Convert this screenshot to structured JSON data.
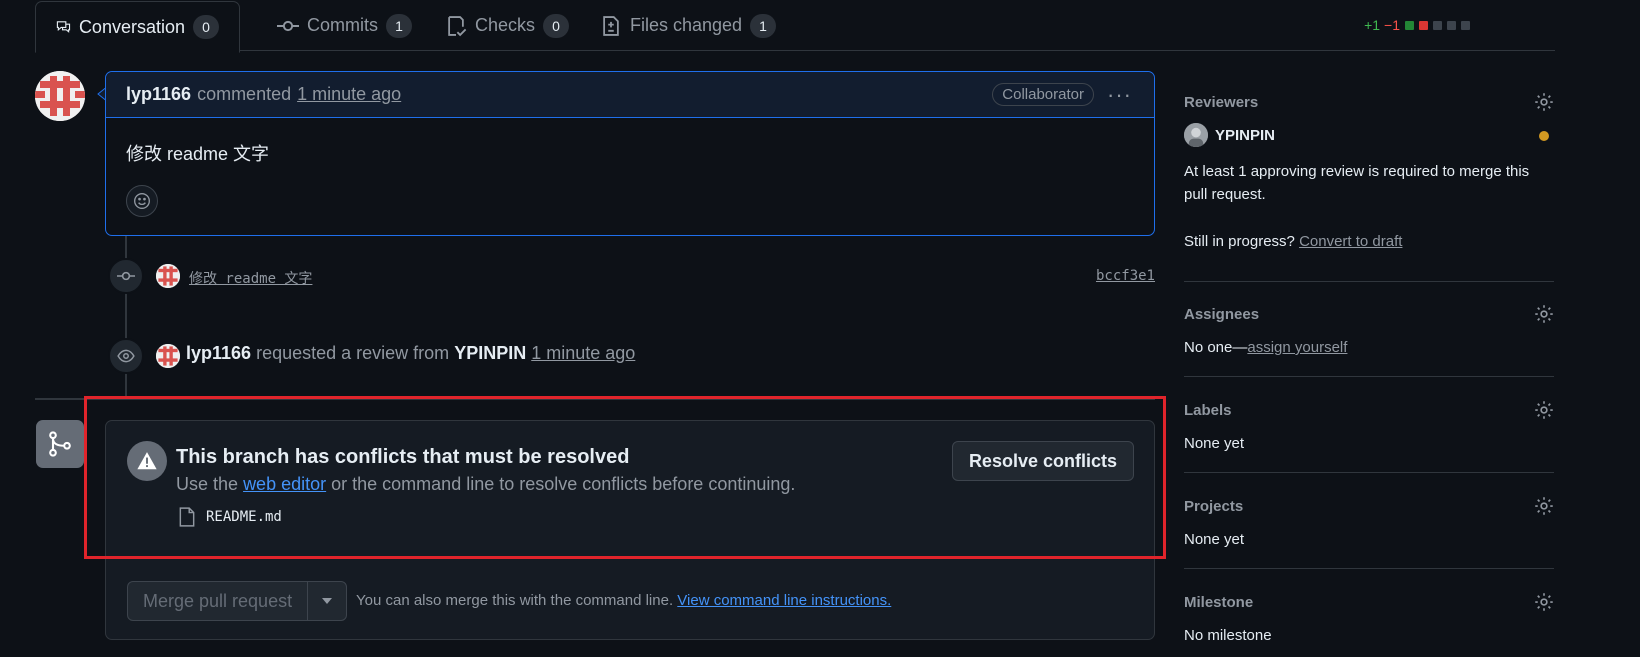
{
  "tabs": [
    {
      "label": "Conversation",
      "count": "0",
      "icon": "comment-discussion-icon"
    },
    {
      "label": "Commits",
      "count": "1",
      "icon": "git-commit-icon"
    },
    {
      "label": "Checks",
      "count": "0",
      "icon": "checklist-icon"
    },
    {
      "label": "Files changed",
      "count": "1",
      "icon": "file-diff-icon"
    }
  ],
  "diffstat": {
    "additions": "+1",
    "deletions": "−1",
    "add_color": "#238636",
    "del_color": "#da3633",
    "neutral_color": "#3d444d"
  },
  "comment": {
    "author": "lyp1166",
    "verb": "commented",
    "time": "1 minute ago",
    "role_badge": "Collaborator",
    "body": "修改 readme 文字"
  },
  "timeline": {
    "commit_message": "修改 readme 文字",
    "commit_sha": "bccf3e1",
    "review_event": {
      "actor": "lyp1166",
      "text": "requested a review from",
      "reviewer": "YPINPIN",
      "time": "1 minute ago"
    }
  },
  "merge": {
    "conflict_title": "This branch has conflicts that must be resolved",
    "conflict_pre": "Use the",
    "conflict_link": "web editor",
    "conflict_post": "or the command line to resolve conflicts before continuing.",
    "conflict_file": "README.md",
    "resolve_button": "Resolve conflicts",
    "merge_button": "Merge pull request",
    "note_pre": "You can also merge this with the command line.",
    "note_link": "View command line instructions."
  },
  "sidebar": {
    "reviewers": {
      "title": "Reviewers",
      "reviewer_name": "YPINPIN",
      "notice": "At least 1 approving review is required to merge this pull request.",
      "draft_pre": "Still in progress?",
      "draft_link": "Convert to draft"
    },
    "assignees": {
      "title": "Assignees",
      "text_pre": "No one—",
      "text_link": "assign yourself"
    },
    "labels": {
      "title": "Labels",
      "text": "None yet"
    },
    "projects": {
      "title": "Projects",
      "text": "None yet"
    },
    "milestone": {
      "title": "Milestone",
      "text": "No milestone"
    }
  },
  "colors": {
    "accent_blue": "#1f6feb",
    "link_blue": "#4493f8",
    "highlight_red": "#e0242b",
    "pending_dot": "#d29922"
  }
}
